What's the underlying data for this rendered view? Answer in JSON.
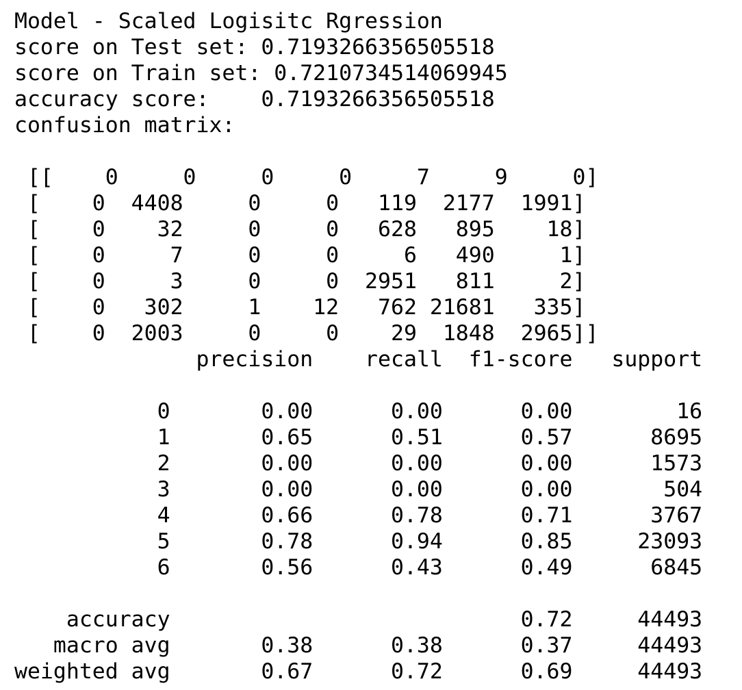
{
  "output": {
    "model_line": "Model - Scaled Logisitc Rgression",
    "test_score_line": "score on Test set: 0.7193266356505518",
    "train_score_line": "score on Train set: 0.7210734514069945",
    "accuracy_line": "accuracy score:    0.7193266356505518",
    "confusion_label": "confusion matrix:",
    "confusion_matrix_rows": [
      " [[    0     0     0     0     7     9     0]",
      " [    0  4408     0     0   119  2177  1991]",
      " [    0    32     0     0   628   895    18]",
      " [    0     7     0     0     6   490     1]",
      " [    0     3     0     0  2951   811     2]",
      " [    0   302     1    12   762 21681   335]",
      " [    0  2003     0     0    29  1848  2965]]"
    ],
    "report_header": "              precision    recall  f1-score   support",
    "report_rows": [
      "           0       0.00      0.00      0.00        16",
      "           1       0.65      0.51      0.57      8695",
      "           2       0.00      0.00      0.00      1573",
      "           3       0.00      0.00      0.00       504",
      "           4       0.66      0.78      0.71      3767",
      "           5       0.78      0.94      0.85     23093",
      "           6       0.56      0.43      0.49      6845"
    ],
    "report_accuracy": "    accuracy                           0.72     44493",
    "report_macro_avg": "   macro avg       0.38      0.38      0.37     44493",
    "report_weighted_avg": "weighted avg       0.67      0.72      0.69     44493"
  }
}
